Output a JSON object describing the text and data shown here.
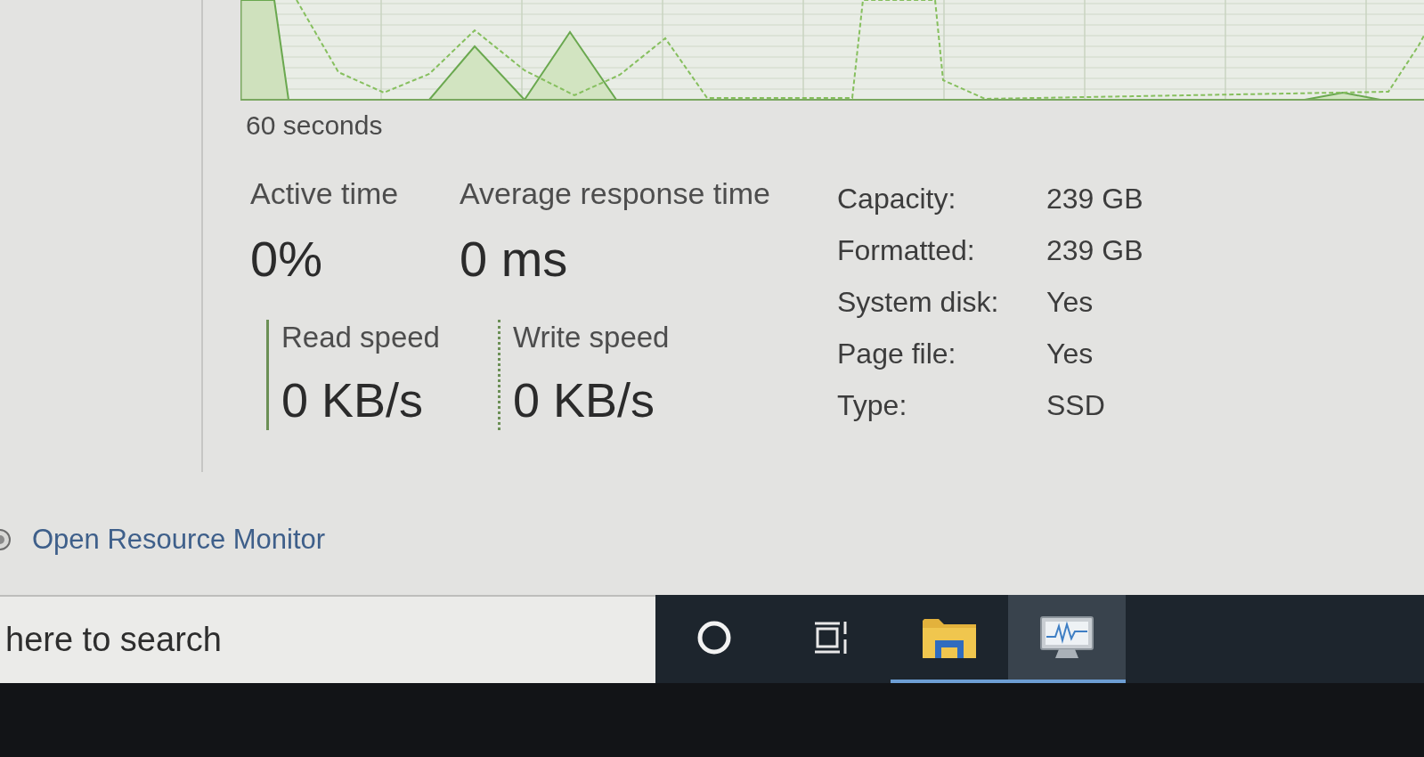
{
  "graph": {
    "time_label": "60 seconds"
  },
  "stats": [
    {
      "label": "Active time",
      "value": "0%"
    },
    {
      "label": "Average response time",
      "value": "0 ms"
    }
  ],
  "speeds": [
    {
      "label": "Read speed",
      "value": "0 KB/s",
      "dotted_line": false
    },
    {
      "label": "Write speed",
      "value": "0 KB/s",
      "dotted_line": true
    }
  ],
  "properties": [
    {
      "label": "Capacity:",
      "value": "239 GB"
    },
    {
      "label": "Formatted:",
      "value": "239 GB"
    },
    {
      "label": "System disk:",
      "value": "Yes"
    },
    {
      "label": "Page file:",
      "value": "Yes"
    },
    {
      "label": "Type:",
      "value": "SSD"
    }
  ],
  "resource_monitor_link": {
    "label": "Open Resource Monitor"
  },
  "taskbar": {
    "search": {
      "placeholder": "here to search"
    },
    "items": [
      {
        "kind": "cortana",
        "running": false,
        "selected": false
      },
      {
        "kind": "task-view",
        "running": false,
        "selected": false
      },
      {
        "kind": "file-explorer",
        "running": true,
        "selected": false
      },
      {
        "kind": "resource-monitor",
        "running": true,
        "selected": true
      }
    ]
  }
}
